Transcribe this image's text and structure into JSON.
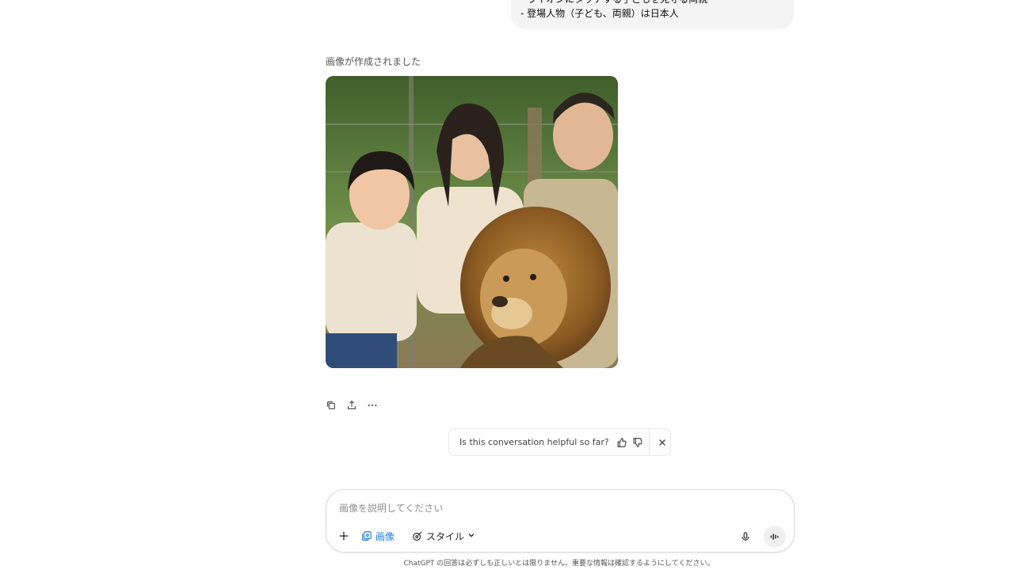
{
  "user_message": {
    "lines": [
      "- ライオンにタッチする子どもを見守る両親",
      "- 登場人物（子ども、両親）は日本人"
    ]
  },
  "assistant": {
    "status_label": "画像が作成されました",
    "image_icon": "generated-image-family-with-lion"
  },
  "message_actions": {
    "icons": [
      "copy-icon",
      "share-icon",
      "more-icon"
    ]
  },
  "feedback": {
    "question": "Is this conversation helpful so far?",
    "icons": [
      "thumbs-up-icon",
      "thumbs-down-icon",
      "close-icon"
    ]
  },
  "composer": {
    "placeholder": "画像を説明してください",
    "image_tool_label": "画像",
    "style_tool_label": "スタイル",
    "accent_color": "#1f7ae0"
  },
  "footer": {
    "disclaimer": "ChatGPT の回答は必ずしも正しいとは限りません。重要な情報は確認するようにしてください。"
  }
}
